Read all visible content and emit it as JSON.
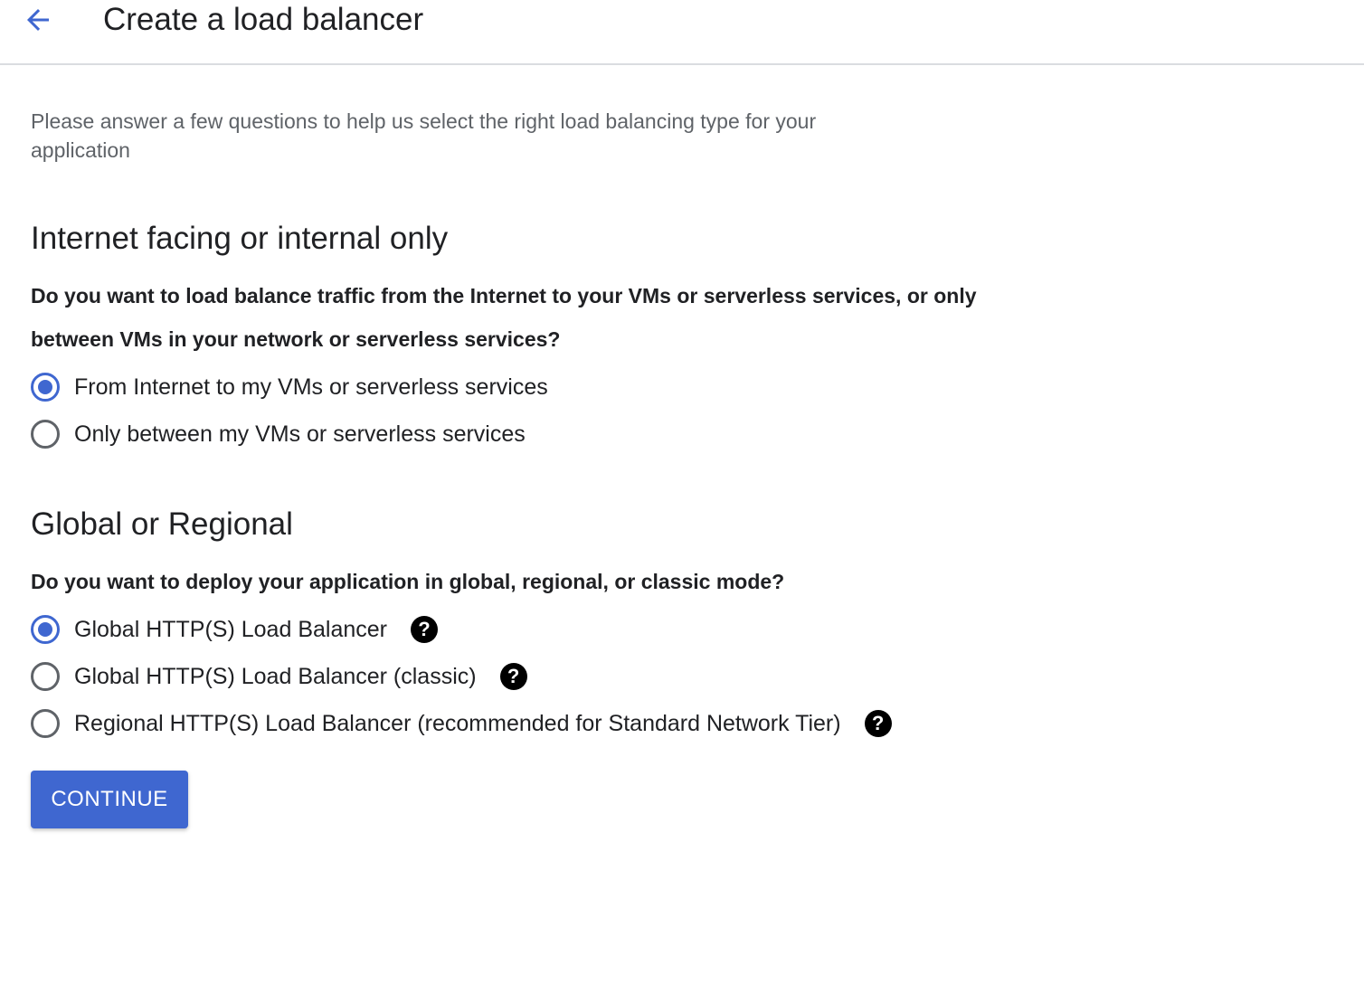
{
  "header": {
    "title": "Create a load balancer",
    "back_icon": "arrow-back-icon"
  },
  "intro": "Please answer a few questions to help us select the right load balancing type for your application",
  "sections": [
    {
      "title": "Internet facing or internal only",
      "question": "Do you want to load balance traffic from the Internet to your VMs or serverless services, or only between VMs in your network or serverless services?",
      "options": [
        {
          "label": "From Internet to my VMs or serverless services",
          "checked": true
        },
        {
          "label": "Only between my VMs or serverless services",
          "checked": false
        }
      ]
    },
    {
      "title": "Global or Regional",
      "question": "Do you want to deploy your application in global, regional, or classic mode?",
      "options": [
        {
          "label": "Global HTTP(S) Load Balancer",
          "checked": true,
          "help_icon": "help-icon"
        },
        {
          "label": "Global HTTP(S) Load Balancer (classic)",
          "checked": false,
          "help_icon": "help-icon"
        },
        {
          "label": "Regional HTTP(S) Load Balancer (recommended for Standard Network Tier)",
          "checked": false,
          "help_icon": "help-icon"
        }
      ]
    }
  ],
  "help_glyph": "?",
  "continue_label": "CONTINUE",
  "colors": {
    "accent": "#3f67d0",
    "text": "#202124",
    "muted": "#5f6368",
    "divider": "#dadce0"
  }
}
